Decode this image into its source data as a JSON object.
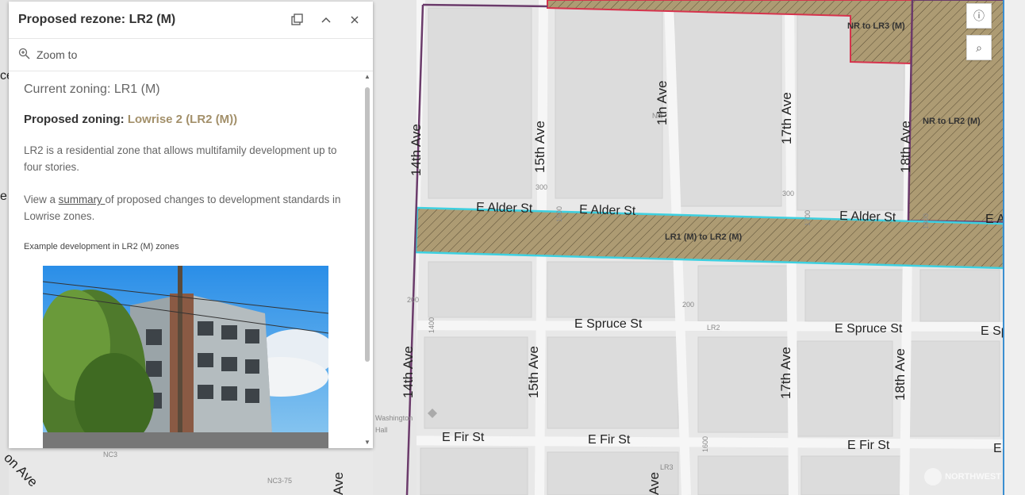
{
  "popup": {
    "title": "Proposed rezone: LR2 (M)",
    "zoom_to": "Zoom to",
    "current_zoning": "Current zoning: LR1 (M)",
    "proposed_label": "Proposed zoning: ",
    "proposed_value": "Lowrise 2 (LR2 (M))",
    "description": "LR2 is a residential zone that allows multifamily development up to four stories.",
    "view_prefix": "View a ",
    "summary_link": "summary ",
    "view_suffix": "of proposed changes to development standards in Lowrise zones.",
    "caption": "Example development in LR2 (M) zones"
  },
  "map": {
    "streets_vertical": [
      "14th Ave",
      "15th Ave",
      "1th Ave",
      "17th Ave",
      "18th Ave",
      "14th Ave",
      "15th Ave",
      "17th Ave",
      "18th Ave",
      "Ave",
      "Ave"
    ],
    "streets_horizontal": [
      "E Alder St",
      "E Alder St",
      "E Alder St",
      "E A",
      "E Spruce St",
      "E Spruce St",
      "E Sp",
      "E Fir St",
      "E Fir St",
      "E Fir St",
      "E"
    ],
    "zone_labels": [
      "LR1 (M) to LR2 (M)",
      "NR to LR3 (M)",
      "NR to LR2 (M)"
    ],
    "small_labels": [
      "300",
      "300",
      "1500",
      "1700",
      "1800",
      "200",
      "1400",
      "200",
      "LR2",
      "NR",
      "Washington",
      "Hall",
      "1600",
      "LR3",
      "NC3-75",
      "NC3",
      "ce",
      "e",
      "on Ave"
    ],
    "watermark": "NORTHWEST"
  },
  "colors": {
    "accent": "#a3906a",
    "rezone_fill": "#a89670",
    "cyan_outline": "#3ed0e0",
    "boundary": "#6b3b6b",
    "red_outline": "#d6334d"
  }
}
